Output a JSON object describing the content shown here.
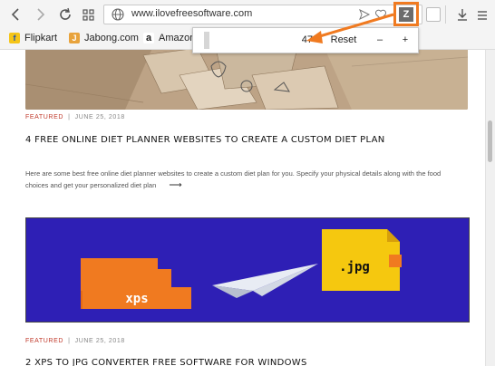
{
  "browser": {
    "url_domain": "www.ilovefreesoftware.com",
    "extension_icon_letter": "Z",
    "accent": "#f07a20"
  },
  "bookmarks": [
    {
      "label": "Flipkart",
      "icon": "flipkart-icon",
      "color": "#f5c518"
    },
    {
      "label": "Jabong.com",
      "icon": "jabong-icon",
      "color": "#e8a33c"
    },
    {
      "label": "Amazon",
      "icon": "amazon-icon",
      "color": "#222222"
    }
  ],
  "zoom_popup": {
    "value": "47",
    "reset_label": "Reset",
    "minus_label": "–",
    "plus_label": "+"
  },
  "posts": [
    {
      "category": "FEATURED",
      "date": "JUNE 25, 2018",
      "title": "4 FREE ONLINE DIET PLANNER WEBSITES TO CREATE A CUSTOM DIET PLAN",
      "excerpt_line1": "Here are some best free online diet planner websites to create a custom diet plan for you. Specify your physical details along with the food",
      "excerpt_line2": "choices and get your personalized diet plan",
      "arrow": "⟶"
    },
    {
      "category": "FEATURED",
      "date": "JUNE 25, 2018",
      "title": "2 XPS TO JPG CONVERTER FREE SOFTWARE FOR WINDOWS",
      "image_left_label": "xps",
      "image_right_label": ".jpg"
    }
  ]
}
